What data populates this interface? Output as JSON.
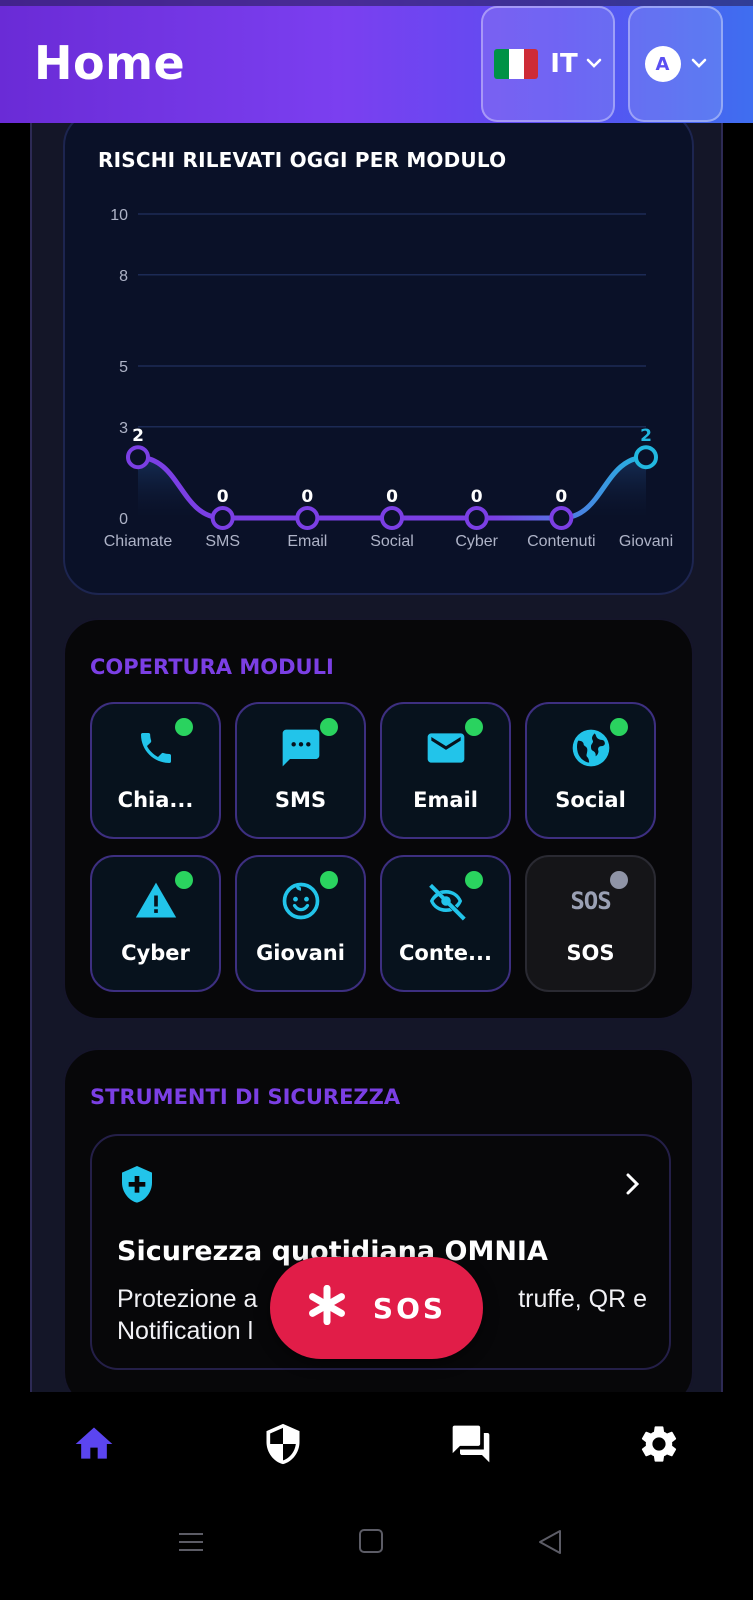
{
  "header": {
    "title": "Home",
    "language_code": "IT",
    "theme_letter": "A",
    "flag_colors": [
      "#009246",
      "#ffffff",
      "#ce2b37"
    ]
  },
  "chart_card": {
    "title": "RISCHI RILEVATI OGGI PER MODULO"
  },
  "chart_data": {
    "type": "line",
    "title": "RISCHI RILEVATI OGGI PER MODULO",
    "categories": [
      "Chiamate",
      "SMS",
      "Email",
      "Social",
      "Cyber",
      "Contenuti",
      "Giovani"
    ],
    "values": [
      2,
      0,
      0,
      0,
      0,
      0,
      2
    ],
    "data_labels": [
      "2",
      "0",
      "0",
      "0",
      "0",
      "0",
      "2"
    ],
    "y_ticks": [
      "0",
      "3",
      "5",
      "8",
      "10"
    ],
    "ylim": [
      0,
      10
    ],
    "grid": true,
    "line_gradient": [
      "#7b3fe4",
      "#22b8e0"
    ]
  },
  "coverage": {
    "title": "COPERTURA MODULI",
    "modules": [
      {
        "label": "Chia...",
        "icon": "phone-icon",
        "status": "active"
      },
      {
        "label": "SMS",
        "icon": "message-icon",
        "status": "active"
      },
      {
        "label": "Email",
        "icon": "email-icon",
        "status": "active"
      },
      {
        "label": "Social",
        "icon": "globe-icon",
        "status": "active"
      },
      {
        "label": "Cyber",
        "icon": "warning-icon",
        "status": "active"
      },
      {
        "label": "Giovani",
        "icon": "child-face-icon",
        "status": "active"
      },
      {
        "label": "Conte...",
        "icon": "eye-off-icon",
        "status": "active"
      },
      {
        "label": "SOS",
        "icon": "sos-icon",
        "icon_text": "SOS",
        "status": "inactive"
      }
    ]
  },
  "tools": {
    "title": "STRUMENTI DI SICUREZZA",
    "items": [
      {
        "title": "Sicurezza quotidiana OMNIA",
        "description": "Protezione anti truffe, QR e Notification l",
        "description_visible_left": "Protezione a",
        "description_visible_right": "truffe, QR e",
        "description_line2": "Notification l"
      }
    ]
  },
  "sos_button": {
    "label": "SOS"
  },
  "colors": {
    "accent": "#7b3fe4",
    "cyan": "#22b8e0",
    "active_dot": "#2ad35f",
    "sos_red": "#e11d48"
  }
}
